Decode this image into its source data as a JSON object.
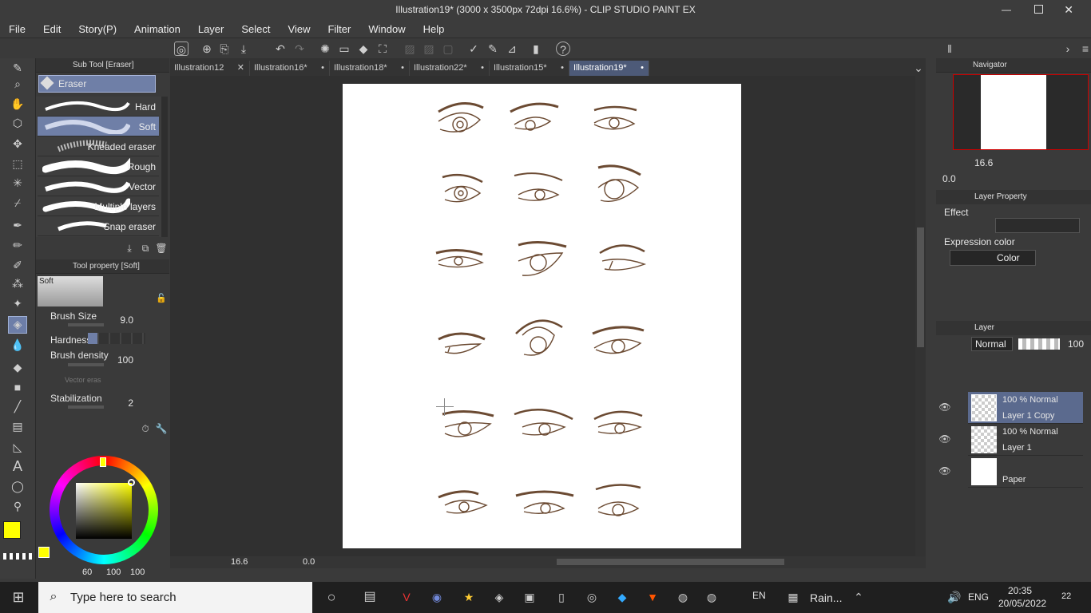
{
  "window": {
    "title": "Illustration19* (3000 x 3500px 72dpi 16.6%) - CLIP STUDIO PAINT EX"
  },
  "menu": [
    "File",
    "Edit",
    "Story(P)",
    "Animation",
    "Layer",
    "Select",
    "View",
    "Filter",
    "Window",
    "Help"
  ],
  "subtool": {
    "header": "Sub Tool [Eraser]",
    "group": "Eraser",
    "brushes": [
      {
        "label": "Hard"
      },
      {
        "label": "Soft"
      },
      {
        "label": "Kneaded eraser"
      },
      {
        "label": "Rough"
      },
      {
        "label": "Vector"
      },
      {
        "label": "Multiple layers"
      },
      {
        "label": "Snap eraser"
      }
    ]
  },
  "toolprop": {
    "header": "Tool property [Soft]",
    "preview_label": "Soft",
    "brush_size_label": "Brush Size",
    "brush_size_value": "9.0",
    "hardness_label": "Hardness",
    "brush_density_label": "Brush density",
    "brush_density_value": "100",
    "vector_label": "Vector eras",
    "stabilization_label": "Stabilization",
    "stabilization_value": "2"
  },
  "color": {
    "main": "#ffff00",
    "sub": "#ffffff",
    "h": "60",
    "s": "100",
    "v": "100"
  },
  "tabs": [
    {
      "label": "Illustration12",
      "active": false
    },
    {
      "label": "Illustration16*",
      "active": false
    },
    {
      "label": "Illustration18*",
      "active": false
    },
    {
      "label": "Illustration22*",
      "active": false
    },
    {
      "label": "Illustration15*",
      "active": false
    },
    {
      "label": "Illustration19*",
      "active": true
    }
  ],
  "canvas_status": {
    "zoom": "16.6",
    "rotation": "0.0"
  },
  "navigator": {
    "header": "Navigator",
    "zoom": "16.6",
    "rotation": "0.0"
  },
  "layer_property": {
    "header": "Layer Property",
    "effect_label": "Effect",
    "expression_label": "Expression color",
    "expression_value": "Color"
  },
  "layer_panel": {
    "header": "Layer",
    "blend_mode": "Normal",
    "opacity": "100",
    "layers": [
      {
        "mode": "100 % Normal",
        "name": "Layer 1 Copy",
        "selected": true
      },
      {
        "mode": "100 % Normal",
        "name": "Layer 1",
        "selected": false
      },
      {
        "mode": "",
        "name": "Paper",
        "selected": false
      }
    ]
  },
  "taskbar": {
    "search_placeholder": "Type here to search",
    "lang": "EN",
    "weather": "Rain...",
    "keyboard": "ENG",
    "time": "20:35",
    "date": "20/05/2022",
    "notifications": "22"
  }
}
